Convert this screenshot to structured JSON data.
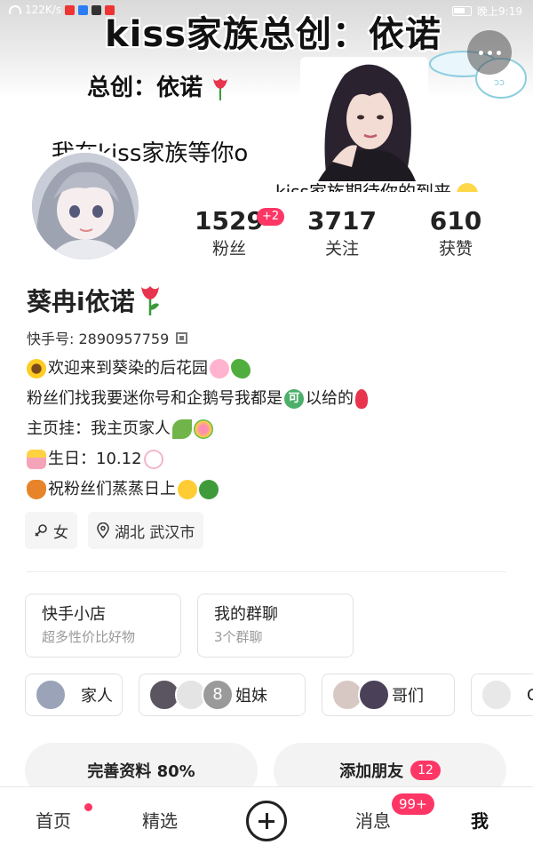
{
  "status_bar": {
    "speed": "122K/s",
    "time": "晚上9:19"
  },
  "banner": {
    "title": "kiss家族总创：依诺",
    "subtitle": "总创：依诺",
    "line2": "我在kiss家族等你o",
    "line3": "kiss家族期待你的到来"
  },
  "profile": {
    "name": "葵冉i依诺",
    "kuaishou_id": "快手号: 2890957759",
    "stats": [
      {
        "value": "1529",
        "label": "粉丝",
        "badge": "+2"
      },
      {
        "value": "3717",
        "label": "关注"
      },
      {
        "value": "610",
        "label": "获赞"
      }
    ],
    "bio": [
      "欢迎来到葵染的后花园",
      "粉丝们找我要迷你号和企鹅号我都是",
      "以给的",
      "主页挂：我主页家人",
      "生日：10.12",
      "祝粉丝们蒸蒸日上"
    ],
    "bio_kebadge": "可",
    "tags": {
      "gender": "女",
      "location": "湖北 武汉市"
    }
  },
  "services": [
    {
      "title": "快手小店",
      "subtitle": "超多性价比好物"
    },
    {
      "title": "我的群聊",
      "subtitle": "3个群聊"
    }
  ],
  "groups": [
    {
      "name": "家人"
    },
    {
      "name": "姐妹",
      "avatar_text": "8"
    },
    {
      "name": "哥们"
    },
    {
      "name": "C"
    }
  ],
  "actions": {
    "complete_profile": "完善资料 80%",
    "add_friend": "添加朋友",
    "add_friend_badge": "12"
  },
  "nav": {
    "home": "首页",
    "featured": "精选",
    "messages": "消息",
    "messages_badge": "99+",
    "me": "我"
  },
  "colors": {
    "accent": "#fe3666",
    "text": "#222222",
    "muted": "#999999"
  }
}
